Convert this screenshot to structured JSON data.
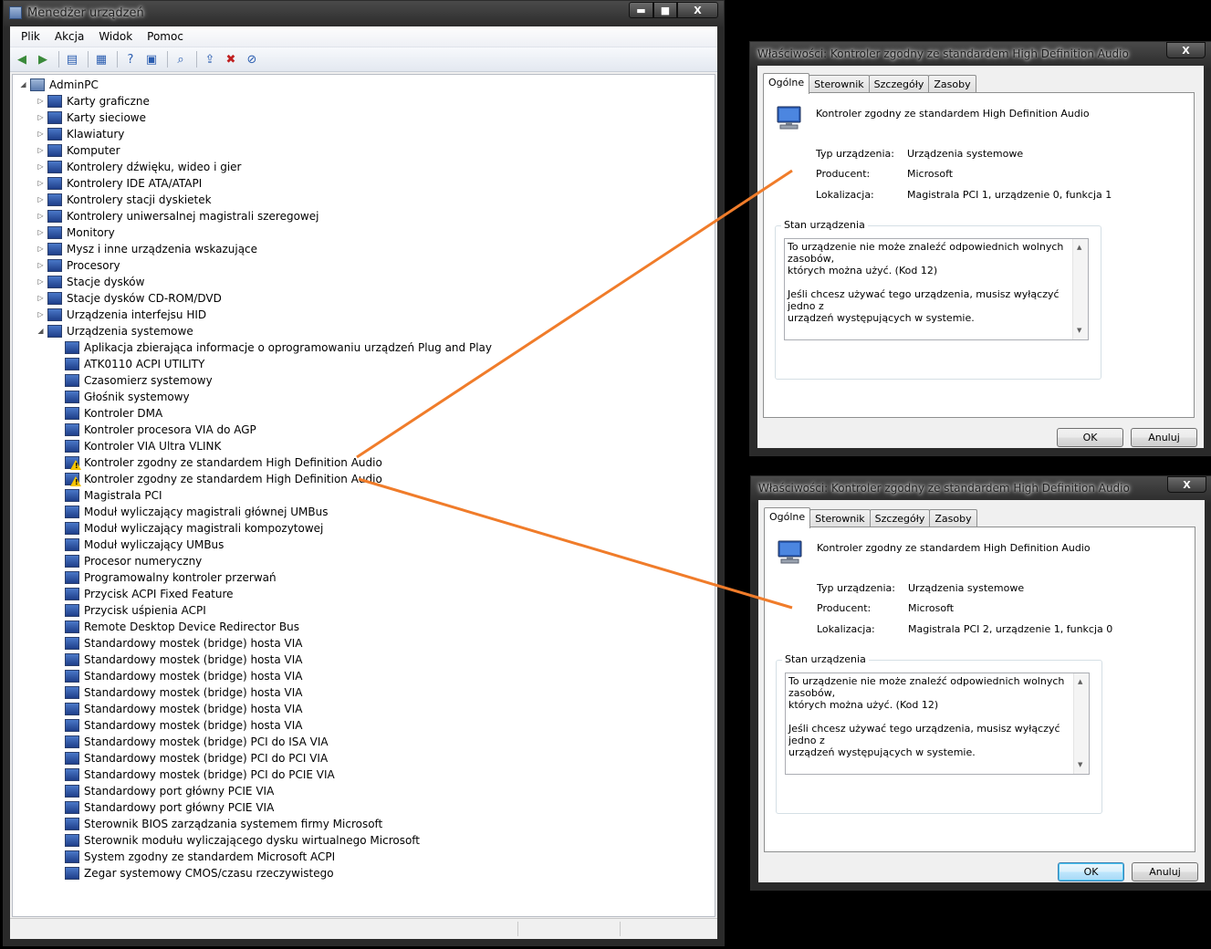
{
  "device_manager": {
    "title": "Menedżer urządzeń",
    "caption_buttons": {
      "minimize": "▬",
      "maximize": "■",
      "close": "X"
    },
    "menu": [
      "Plik",
      "Akcja",
      "Widok",
      "Pomoc"
    ],
    "toolbar_icons": [
      "back-icon",
      "forward-icon",
      "sep",
      "show-hide-tree-icon",
      "sep",
      "properties-icon",
      "sep",
      "help-icon",
      "view-icon",
      "sep",
      "scan-hardware-icon",
      "sep",
      "update-driver-icon",
      "uninstall-icon",
      "disable-icon"
    ],
    "tree": {
      "root": "AdminPC",
      "categories": [
        "Karty graficzne",
        "Karty sieciowe",
        "Klawiatury",
        "Komputer",
        "Kontrolery dźwięku, wideo i gier",
        "Kontrolery IDE ATA/ATAPI",
        "Kontrolery stacji dyskietek",
        "Kontrolery uniwersalnej magistrali szeregowej",
        "Monitory",
        "Mysz i inne urządzenia wskazujące",
        "Procesory",
        "Stacje dysków",
        "Stacje dysków CD-ROM/DVD",
        "Urządzenia interfejsu HID",
        "Urządzenia systemowe"
      ],
      "system_devices": [
        {
          "label": "Aplikacja zbierająca informacje o oprogramowaniu urządzeń Plug and Play",
          "warning": false
        },
        {
          "label": "ATK0110 ACPI UTILITY",
          "warning": false
        },
        {
          "label": "Czasomierz systemowy",
          "warning": false
        },
        {
          "label": "Głośnik systemowy",
          "warning": false
        },
        {
          "label": "Kontroler DMA",
          "warning": false
        },
        {
          "label": "Kontroler procesora VIA do AGP",
          "warning": false
        },
        {
          "label": "Kontroler VIA Ultra VLINK",
          "warning": false
        },
        {
          "label": "Kontroler zgodny ze standardem High Definition Audio",
          "warning": true
        },
        {
          "label": "Kontroler zgodny ze standardem High Definition Audio",
          "warning": true
        },
        {
          "label": "Magistrala PCI",
          "warning": false
        },
        {
          "label": "Moduł wyliczający magistrali głównej UMBus",
          "warning": false
        },
        {
          "label": "Moduł wyliczający magistrali kompozytowej",
          "warning": false
        },
        {
          "label": "Moduł wyliczający UMBus",
          "warning": false
        },
        {
          "label": "Procesor numeryczny",
          "warning": false
        },
        {
          "label": "Programowalny kontroler przerwań",
          "warning": false
        },
        {
          "label": "Przycisk ACPI Fixed Feature",
          "warning": false
        },
        {
          "label": "Przycisk uśpienia ACPI",
          "warning": false
        },
        {
          "label": "Remote Desktop Device Redirector Bus",
          "warning": false
        },
        {
          "label": "Standardowy mostek (bridge) hosta VIA",
          "warning": false
        },
        {
          "label": "Standardowy mostek (bridge) hosta VIA",
          "warning": false
        },
        {
          "label": "Standardowy mostek (bridge) hosta VIA",
          "warning": false
        },
        {
          "label": "Standardowy mostek (bridge) hosta VIA",
          "warning": false
        },
        {
          "label": "Standardowy mostek (bridge) hosta VIA",
          "warning": false
        },
        {
          "label": "Standardowy mostek (bridge) hosta VIA",
          "warning": false
        },
        {
          "label": "Standardowy mostek (bridge) PCI do ISA VIA",
          "warning": false
        },
        {
          "label": "Standardowy mostek (bridge) PCI do PCI VIA",
          "warning": false
        },
        {
          "label": "Standardowy mostek (bridge) PCI do PCIE VIA",
          "warning": false
        },
        {
          "label": "Standardowy port główny PCIE VIA",
          "warning": false
        },
        {
          "label": "Standardowy port główny PCIE VIA",
          "warning": false
        },
        {
          "label": "Sterownik BIOS zarządzania systemem firmy Microsoft",
          "warning": false
        },
        {
          "label": "Sterownik modułu wyliczającego dysku wirtualnego Microsoft",
          "warning": false
        },
        {
          "label": "System zgodny ze standardem Microsoft ACPI",
          "warning": false
        },
        {
          "label": "Zegar systemowy CMOS/czasu rzeczywistego",
          "warning": false
        }
      ]
    }
  },
  "dialogs": [
    {
      "title": "Właściwości: Kontroler zgodny ze standardem High Definition Audio",
      "close": "X",
      "tabs": [
        "Ogólne",
        "Sterownik",
        "Szczegóły",
        "Zasoby"
      ],
      "device_name": "Kontroler zgodny ze standardem High Definition Audio",
      "properties": [
        {
          "key": "Typ urządzenia:",
          "value": "Urządzenia systemowe"
        },
        {
          "key": "Producent:",
          "value": "Microsoft"
        },
        {
          "key": "Lokalizacja:",
          "value": "Magistrala PCI 1, urządzenie 0, funkcja 1"
        }
      ],
      "status_group": "Stan urządzenia",
      "status_text": "To urządzenie nie może znaleźć odpowiednich wolnych zasobów,\nktórych można użyć. (Kod 12)\n\nJeśli chcesz używać tego urządzenia, musisz wyłączyć jedno z\nurządzeń występujących w systemie.",
      "ok": "OK",
      "cancel": "Anuluj"
    },
    {
      "title": "Właściwości: Kontroler zgodny ze standardem High Definition Audio",
      "close": "X",
      "tabs": [
        "Ogólne",
        "Sterownik",
        "Szczegóły",
        "Zasoby"
      ],
      "device_name": "Kontroler zgodny ze standardem High Definition Audio",
      "properties": [
        {
          "key": "Typ urządzenia:",
          "value": "Urządzenia systemowe"
        },
        {
          "key": "Producent:",
          "value": "Microsoft"
        },
        {
          "key": "Lokalizacja:",
          "value": "Magistrala PCI 2, urządzenie 1, funkcja 0"
        }
      ],
      "status_group": "Stan urządzenia",
      "status_text": "To urządzenie nie może znaleźć odpowiednich wolnych zasobów,\nktórych można użyć. (Kod 12)\n\nJeśli chcesz używać tego urządzenia, musisz wyłączyć jedno z\nurządzeń występujących w systemie.",
      "ok": "OK",
      "cancel": "Anuluj"
    }
  ],
  "annotation_color": "#f07c2a"
}
